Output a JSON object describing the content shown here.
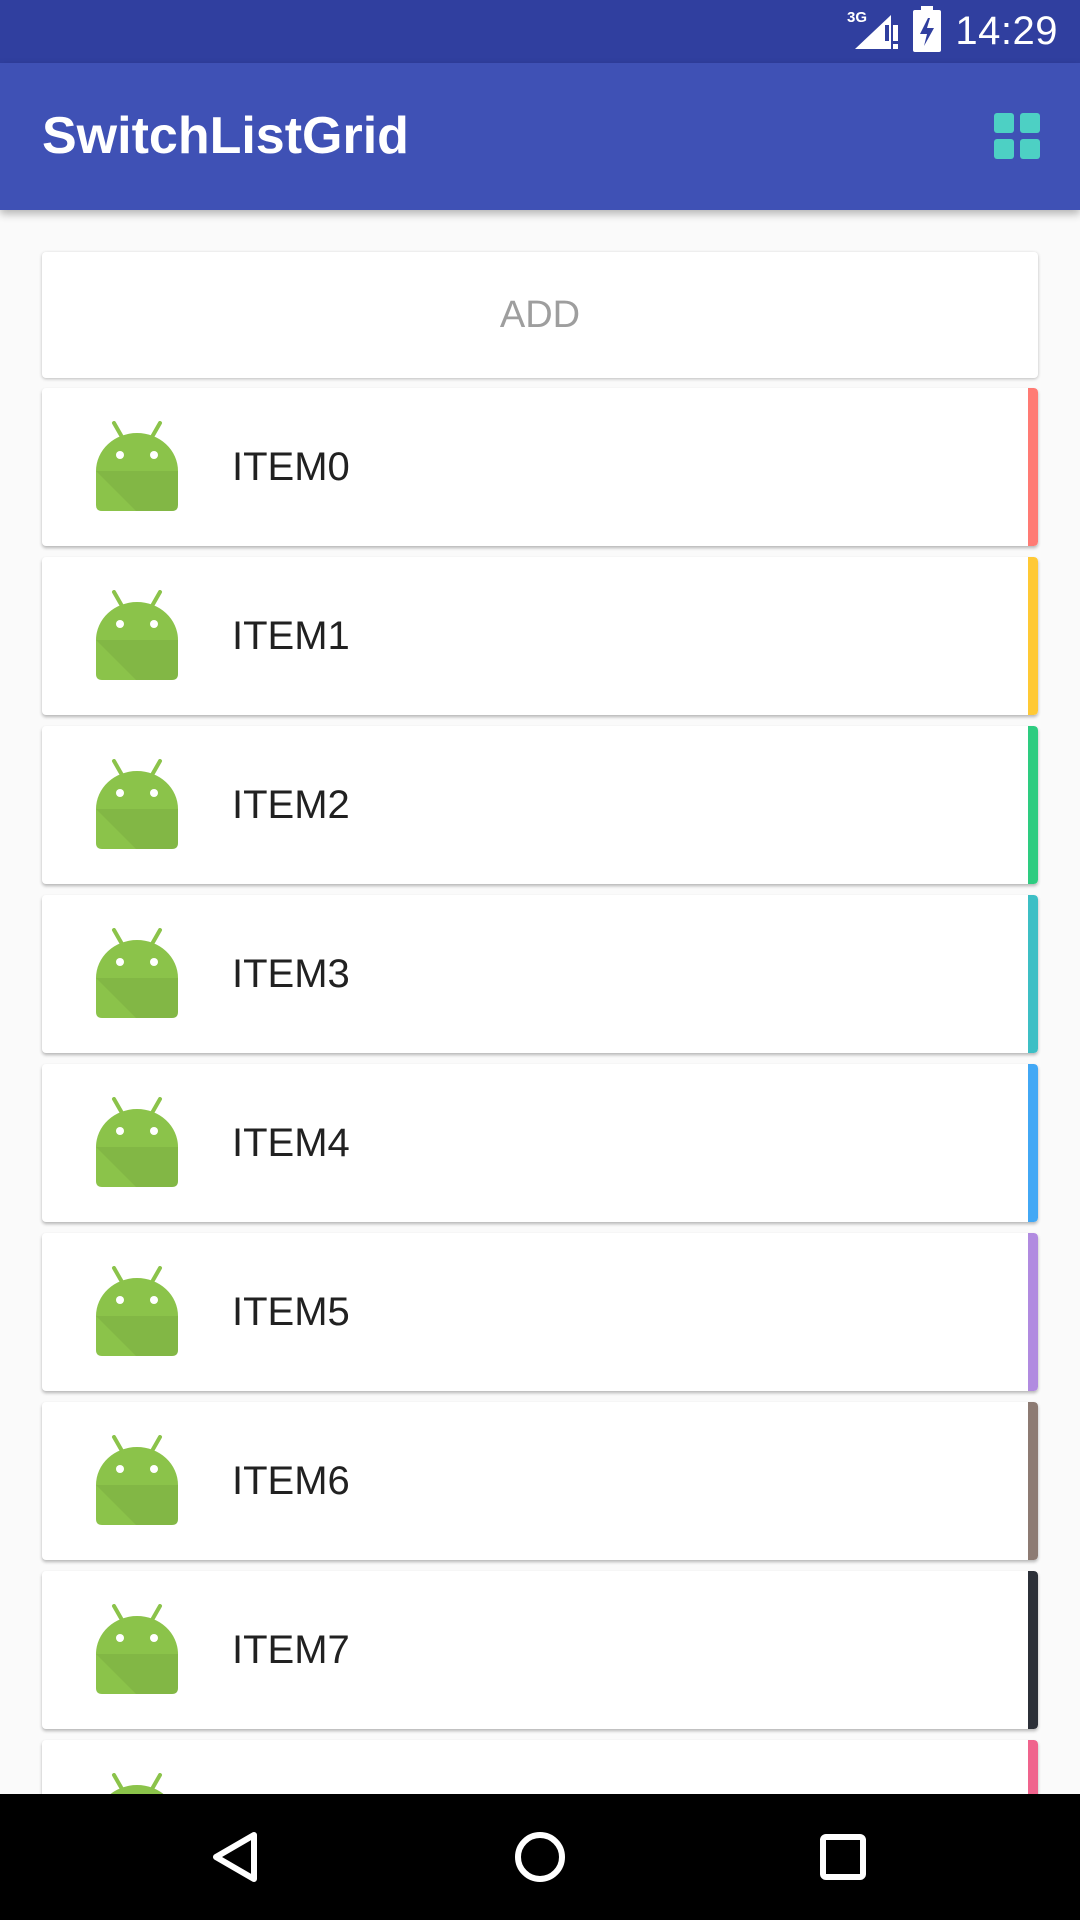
{
  "status_bar": {
    "network": "3G",
    "time": "14:29"
  },
  "app_bar": {
    "title": "SwitchListGrid",
    "toggle_icon": "grid-view-icon",
    "toggle_color": "#4dd0c4"
  },
  "add_button": {
    "label": "ADD"
  },
  "items": [
    {
      "label": "ITEM0",
      "icon": "android-icon",
      "accent": "#ff7b74"
    },
    {
      "label": "ITEM1",
      "icon": "android-icon",
      "accent": "#ffc935"
    },
    {
      "label": "ITEM2",
      "icon": "android-icon",
      "accent": "#2ecc80"
    },
    {
      "label": "ITEM3",
      "icon": "android-icon",
      "accent": "#3dbfc5"
    },
    {
      "label": "ITEM4",
      "icon": "android-icon",
      "accent": "#42a8f5"
    },
    {
      "label": "ITEM5",
      "icon": "android-icon",
      "accent": "#b18be0"
    },
    {
      "label": "ITEM6",
      "icon": "android-icon",
      "accent": "#8d7b73"
    },
    {
      "label": "ITEM7",
      "icon": "android-icon",
      "accent": "#2c3038"
    },
    {
      "label": "",
      "icon": "android-icon",
      "accent": "#f0648d"
    }
  ],
  "colors": {
    "primary": "#3f51b5",
    "primary_dark": "#303f9f",
    "android_green": "#8bc34a"
  },
  "nav_bar": {
    "back_icon": "back-icon",
    "home_icon": "home-icon",
    "recents_icon": "recents-icon"
  }
}
